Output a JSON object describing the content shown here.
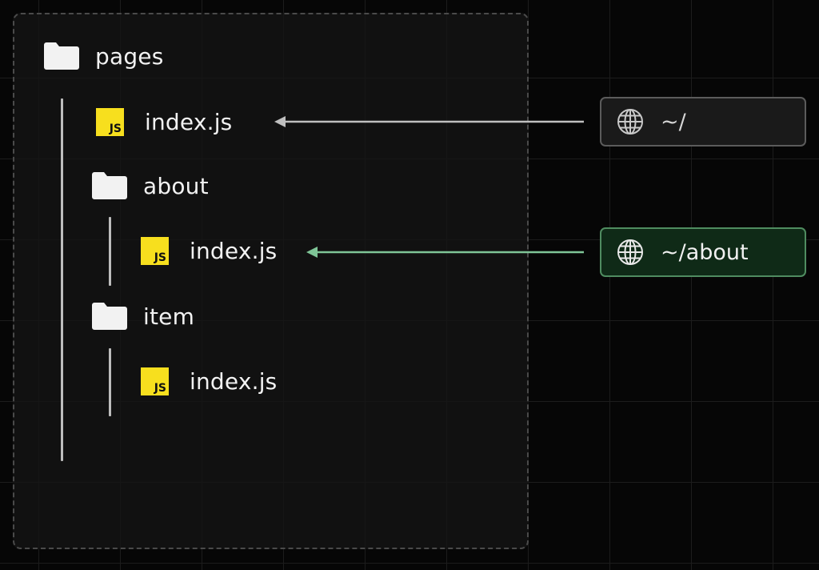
{
  "colors": {
    "background": "#060606",
    "panel": "#141414",
    "panel_border": "#4a4a4a",
    "js_badge": "#f7df1e",
    "folder": "#f2f2f2",
    "arrow_default": "#bfbfbf",
    "arrow_active": "#7fc597",
    "route_active_bg": "#0f2a17",
    "route_active_border": "#4f8c60",
    "route_default_bg": "#1a1a1a",
    "route_default_border": "#5b5b5b"
  },
  "tree": {
    "root": {
      "label": "pages",
      "icon": "folder-icon"
    },
    "root_file": {
      "label": "index.js",
      "icon": "js-icon",
      "badge": "JS"
    },
    "about_folder": {
      "label": "about",
      "icon": "folder-icon"
    },
    "about_file": {
      "label": "index.js",
      "icon": "js-icon",
      "badge": "JS"
    },
    "item_folder": {
      "label": "item",
      "icon": "folder-icon"
    },
    "item_file": {
      "label": "index.js",
      "icon": "js-icon",
      "badge": "JS"
    }
  },
  "routes": [
    {
      "path": "~/",
      "icon": "globe-icon",
      "state": "default"
    },
    {
      "path": "~/about",
      "icon": "globe-icon",
      "state": "active"
    }
  ]
}
